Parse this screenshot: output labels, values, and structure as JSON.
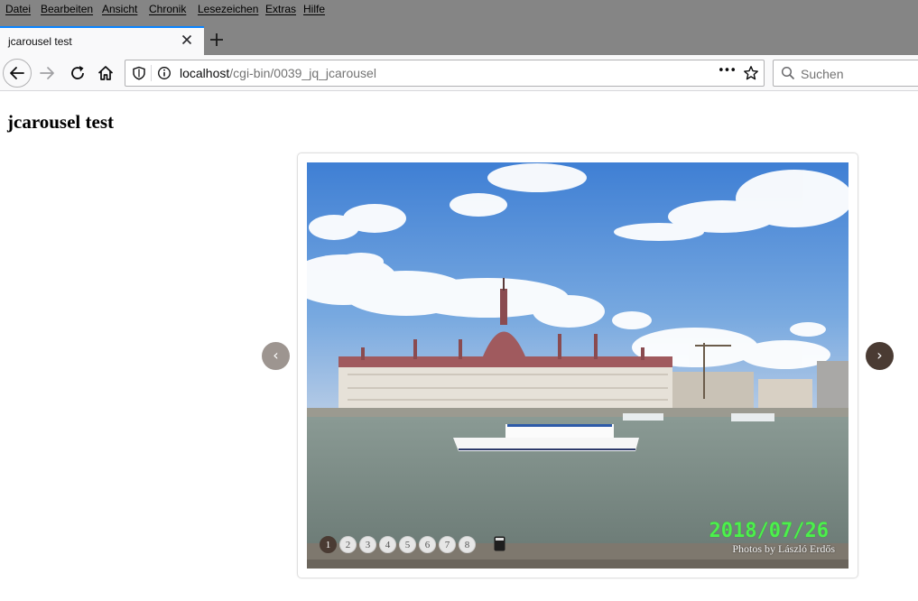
{
  "menubar": {
    "items": [
      "Datei",
      "Bearbeiten",
      "Ansicht",
      "Chronik",
      "Lesezeichen",
      "Extras",
      "Hilfe"
    ]
  },
  "tabs": [
    {
      "title": "jcarousel test",
      "active": true
    }
  ],
  "navbar": {
    "url_host": "localhost",
    "url_path": "/cgi-bin/0039_jq_jcarousel",
    "search_placeholder": "Suchen",
    "more_label": "•••"
  },
  "page": {
    "title": "jcarousel test"
  },
  "carousel": {
    "prev_label": "‹",
    "next_label": "›",
    "pages": [
      "1",
      "2",
      "3",
      "4",
      "5",
      "6",
      "7",
      "8"
    ],
    "active_page": "1",
    "slide": {
      "date_stamp": "2018/07/26",
      "credit": "Photos by László Erdős"
    }
  },
  "colors": {
    "accent": "#0a84ff",
    "arrow_active": "#4a3b33",
    "arrow_inactive": "#9d9590",
    "date_stamp": "#4cf04c"
  }
}
